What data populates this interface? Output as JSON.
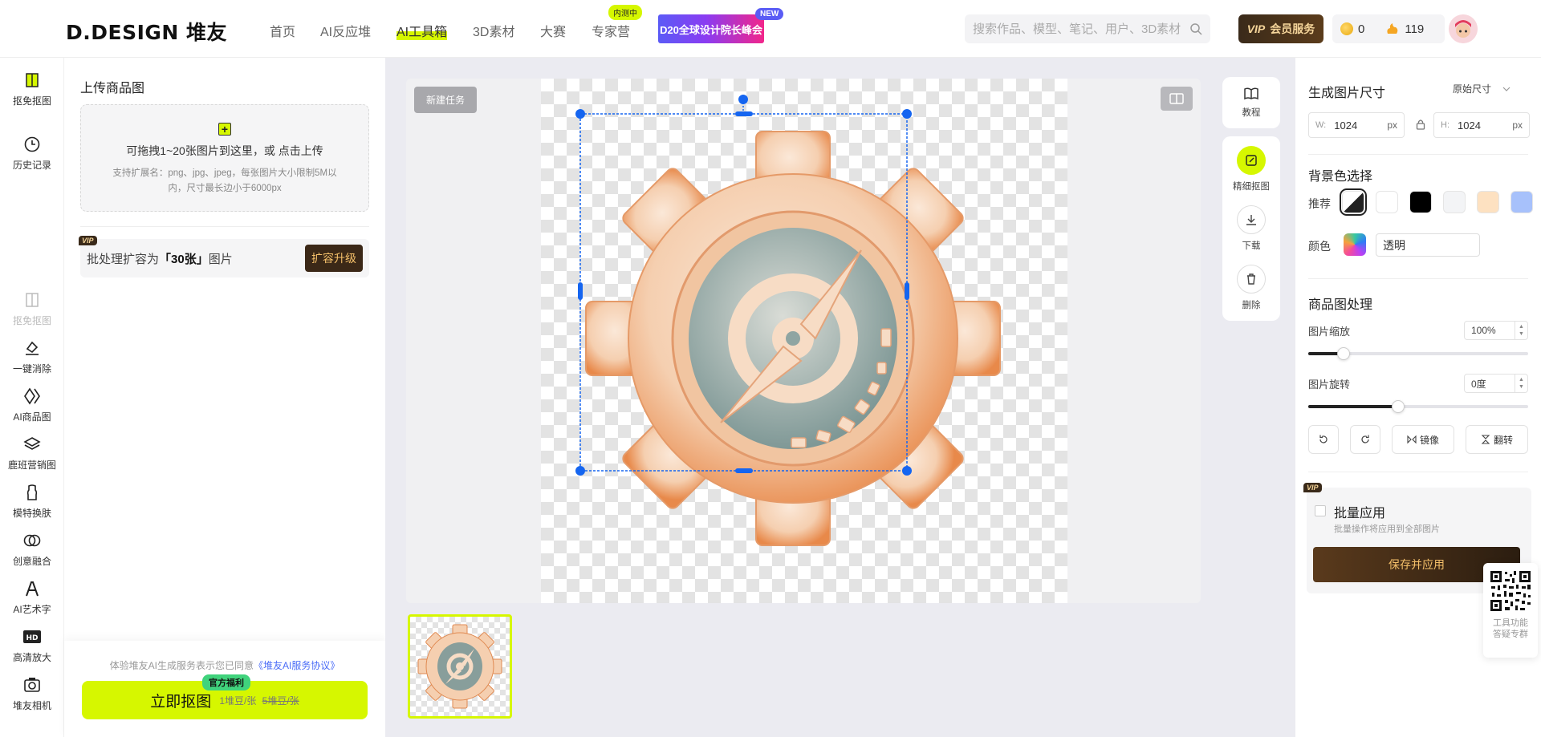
{
  "header": {
    "logo": "D.DESIGN 堆友",
    "nav": [
      "首页",
      "AI反应堆",
      "AI工具箱",
      "3D素材",
      "大赛",
      "专家营"
    ],
    "beta_badge": "内测中",
    "promo": "D20全球设计院长峰会",
    "new_badge": "NEW",
    "search_placeholder": "搜索作品、模型、笔记、用户、3D素材",
    "vip_tag": "VIP",
    "vip_label": "会员服务",
    "coins": "0",
    "points": "119"
  },
  "rail": {
    "items": [
      {
        "label": "抠免抠图",
        "icon": "cutout-icon",
        "dim": false
      },
      {
        "label": "历史记录",
        "icon": "clock-icon",
        "dim": false
      },
      {
        "label": "抠免抠图",
        "icon": "cutout-icon",
        "dim": true
      },
      {
        "label": "一键消除",
        "icon": "eraser-icon",
        "dim": false
      },
      {
        "label": "AI商品图",
        "icon": "diamond-icon",
        "dim": false
      },
      {
        "label": "鹿班营销图",
        "icon": "layers-icon",
        "dim": false
      },
      {
        "label": "模特换肤",
        "icon": "model-icon",
        "dim": false
      },
      {
        "label": "创意融合",
        "icon": "blend-icon",
        "dim": false
      },
      {
        "label": "AI艺术字",
        "icon": "font-icon",
        "dim": false
      },
      {
        "label": "高清放大",
        "icon": "hd-icon",
        "dim": false
      },
      {
        "label": "堆友相机",
        "icon": "camera-icon",
        "dim": false
      }
    ]
  },
  "upload": {
    "title": "上传商品图",
    "drop_main": "可拖拽1~20张图片到这里，或 点击上传",
    "drop_sub": "支持扩展名：png、jpg、jpeg，每张图片大小限制5M以内，尺寸最长边小于6000px",
    "expand_vip": "VIP",
    "expand_prefix": "批处理扩容为",
    "expand_value": "「30张」",
    "expand_suffix": "图片",
    "expand_button": "扩容升级",
    "terms_prefix": "体验堆友AI生成服务表示您已同意",
    "terms_link": "《堆友AI服务协议》",
    "go_button": "立即抠图",
    "go_badge": "官方福利",
    "price_now": "1堆豆/张",
    "price_old": "5堆豆/张"
  },
  "workspace": {
    "new_task": "新建任务",
    "tools_top": [
      {
        "label": "教程",
        "icon": "book-icon"
      }
    ],
    "tools": [
      {
        "label": "精细抠图",
        "icon": "edit-icon",
        "active": true
      },
      {
        "label": "下载",
        "icon": "download-icon",
        "active": false
      },
      {
        "label": "删除",
        "icon": "trash-icon",
        "active": false
      }
    ]
  },
  "settings": {
    "size_title": "生成图片尺寸",
    "size_mode": "原始尺寸",
    "width_label": "W:",
    "width": "1024",
    "height_label": "H:",
    "height": "1024",
    "unit": "px",
    "bg_title": "背景色选择",
    "recommend_label": "推荐",
    "swatches": [
      "#ffffff",
      "#ffffff",
      "#000000",
      "#f3f4f6",
      "#fde1c1",
      "#a7c1fb"
    ],
    "color_label": "颜色",
    "color_value": "透明",
    "process_title": "商品图处理",
    "scale_label": "图片缩放",
    "scale_value": "100%",
    "scale_fraction": 0.16,
    "rotate_label": "图片旋转",
    "rotate_value": "0度",
    "rotate_fraction": 0.41,
    "mirror_label": "镜像",
    "flip_label": "翻转",
    "batch_vip": "VIP",
    "batch_title": "批量应用",
    "batch_sub": "批量操作将应用到全部图片",
    "batch_button": "保存并应用",
    "qr_text_1": "工具功能",
    "qr_text_2": "答疑专群"
  },
  "colors": {
    "accent": "#d6f700",
    "handle": "#1565f0",
    "vip_dark": "#3a2a1a"
  }
}
